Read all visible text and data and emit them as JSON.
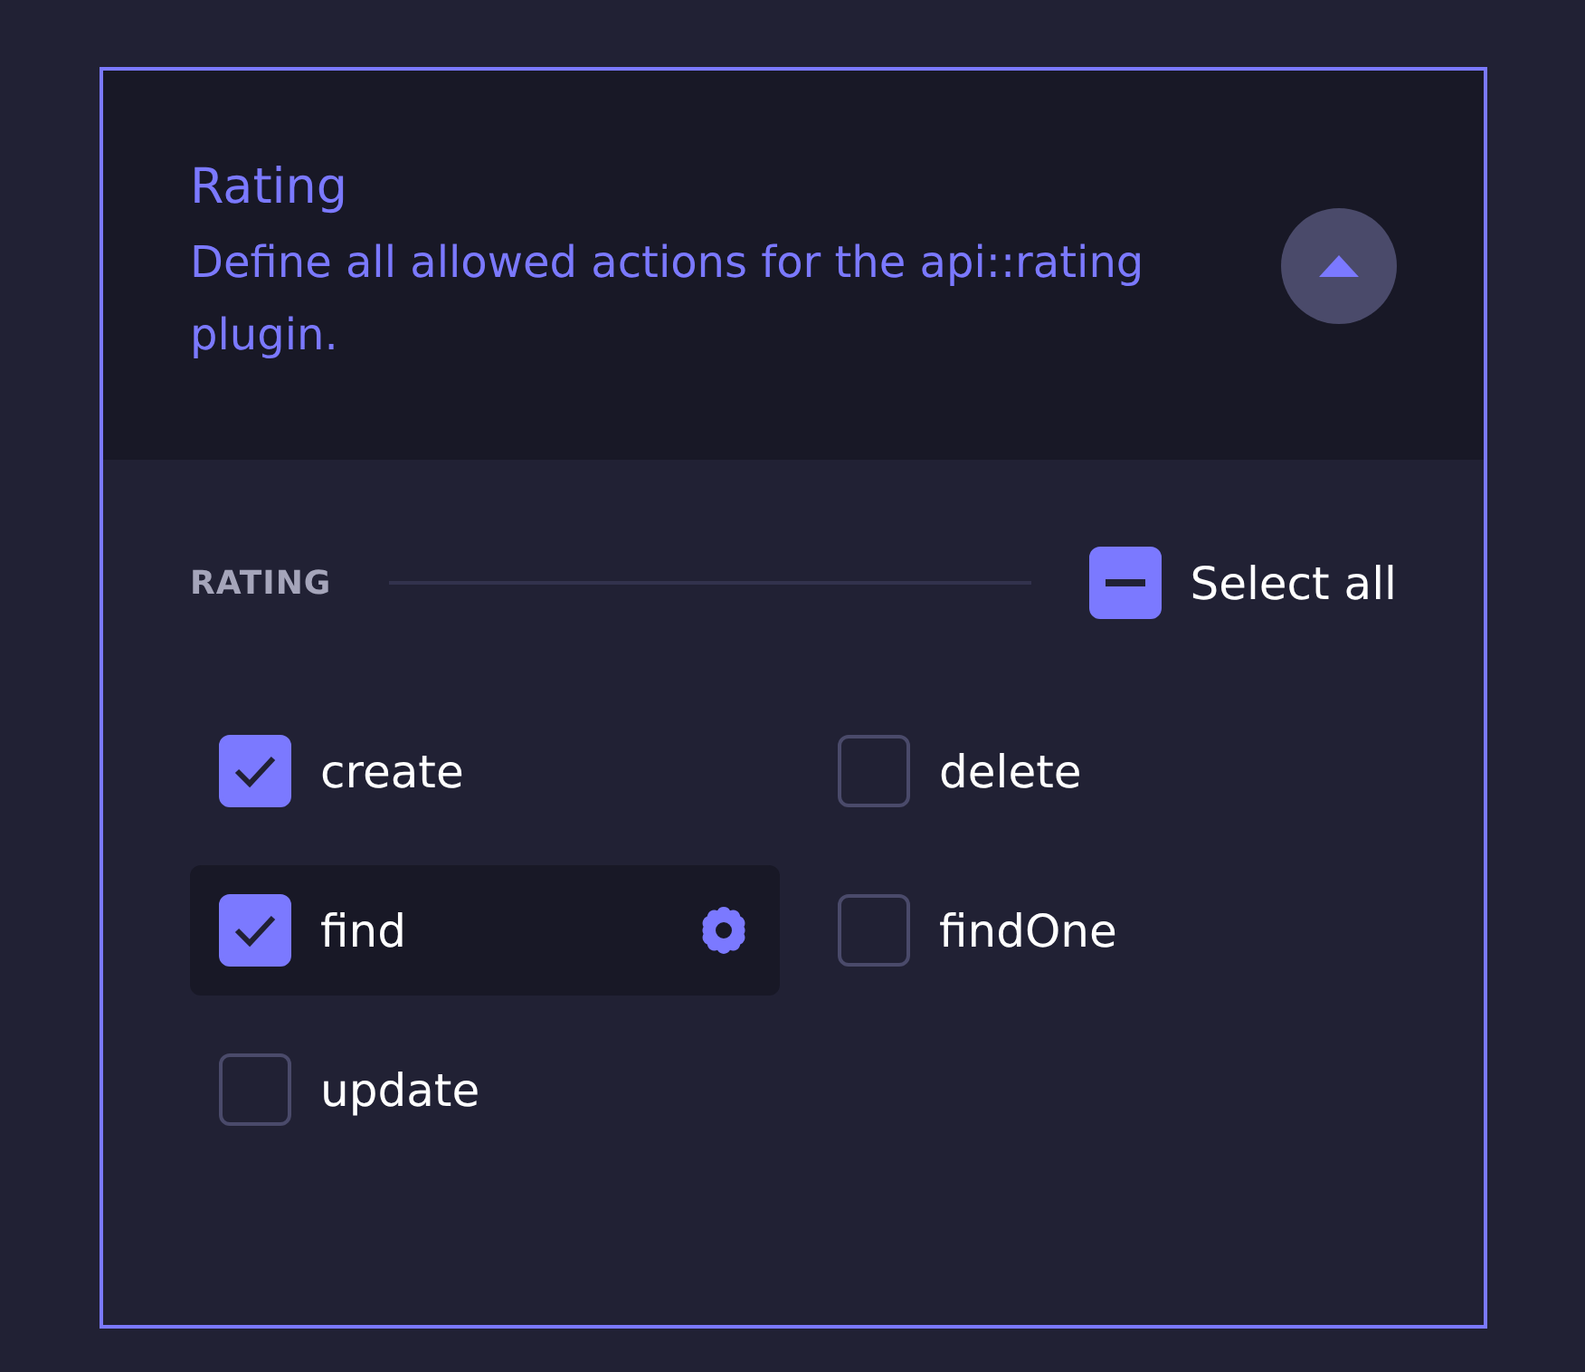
{
  "section": {
    "title": "Rating",
    "description": "Define all allowed actions for the api::rating plugin.",
    "expanded": true
  },
  "group": {
    "label": "RATING",
    "select_all": {
      "label": "Select all",
      "checked": true,
      "indeterminate": true
    }
  },
  "actions": [
    {
      "label": "create",
      "checked": true,
      "active": false
    },
    {
      "label": "delete",
      "checked": false,
      "active": false
    },
    {
      "label": "find",
      "checked": true,
      "active": true
    },
    {
      "label": "findOne",
      "checked": false,
      "active": false
    },
    {
      "label": "update",
      "checked": false,
      "active": false
    }
  ]
}
